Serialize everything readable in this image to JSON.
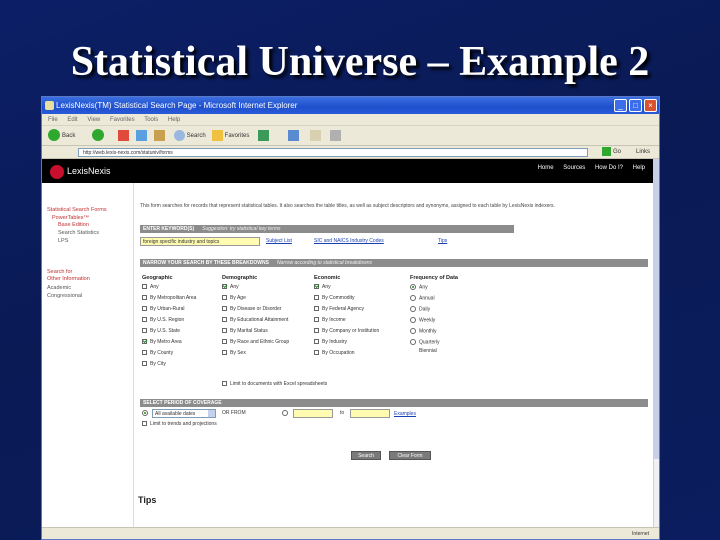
{
  "slide": {
    "title": "Statistical Universe – Example 2"
  },
  "window": {
    "title": "LexisNexis(TM) Statistical Search Page - Microsoft Internet Explorer",
    "controls": {
      "minimize": "_",
      "maximize": "□",
      "close": "×"
    },
    "menu": [
      "File",
      "Edit",
      "View",
      "Favorites",
      "Tools",
      "Help"
    ],
    "toolbar": {
      "back": "Back",
      "search": "Search",
      "favorites": "Favorites"
    },
    "address": {
      "url": "http://web.lexis-nexis.com/statuniv/forms",
      "go": "Go",
      "links": "Links"
    },
    "status": {
      "zone": "Internet"
    }
  },
  "page": {
    "logo": "LexisNexis",
    "top_links": [
      "Home",
      "Sources",
      "How Do I?",
      "Help"
    ],
    "sidebar": {
      "heading": "Statistical Search Forms",
      "item1": "PowerTables™",
      "item1b": "Base Edition",
      "item2": "Search Statistics",
      "item3": "LPS",
      "other_heading_1": "Search for",
      "other_heading_2": "Other Information",
      "other_item1": "Academic",
      "other_item2": "Congressional"
    },
    "intro": "This form searches for records that represent statistical tables. It also searches the table titles, as well as subject descriptors and synonyms, assigned to each table by LexisNexis indexers.",
    "keyword": {
      "bar_label": "ENTER KEYWORD(S)",
      "bar_sub": "Suggestion: try statistical key terms",
      "value": "foreign specific industry and topics",
      "subject_list": "Subject List",
      "sic_naics": "SIC and NAICS Industry Codes",
      "tips": "Tips"
    },
    "narrow": {
      "bar_label": "NARROW YOUR SEARCH BY THESE BREAKDOWNS",
      "bar_sub": "Narrow according to statistical breakdowns"
    },
    "columns": {
      "geographic": {
        "heading": "Geographic",
        "options": [
          "Any",
          "By Metropolitan Area",
          "By Urban-Rural",
          "By U.S. Region",
          "By U.S. State",
          "By Metro Area",
          "By County",
          "By City"
        ],
        "checked": [
          5
        ]
      },
      "demographic": {
        "heading": "Demographic",
        "options": [
          "Any",
          "By Age",
          "By Disease or Disorder",
          "By Educational Attainment",
          "By Marital Status",
          "By Race and Ethnic Group",
          "By Sex"
        ],
        "checked": [
          0
        ]
      },
      "economic": {
        "heading": "Economic",
        "options": [
          "Any",
          "By Commodity",
          "By Federal Agency",
          "By Income",
          "By Company or Institution",
          "By Industry",
          "By Occupation"
        ],
        "checked": [
          0
        ]
      },
      "frequency": {
        "heading": "Frequency of Data",
        "options": [
          "Any",
          "Annual",
          "Daily",
          "Weekly",
          "Monthly",
          "Quarterly",
          "Biennial"
        ],
        "selected": 0
      }
    },
    "limit_label": "Limit to documents with Excel spreadsheets",
    "period": {
      "bar_label": "SELECT PERIOD OF COVERAGE",
      "select_value": "All available dates",
      "or_from": "OR FROM",
      "to": "to",
      "examples": "Examples",
      "limit_trends": "Limit to trends and projections"
    },
    "buttons": {
      "search": "Search",
      "clear": "Clear Form"
    },
    "tips_title": "Tips"
  }
}
